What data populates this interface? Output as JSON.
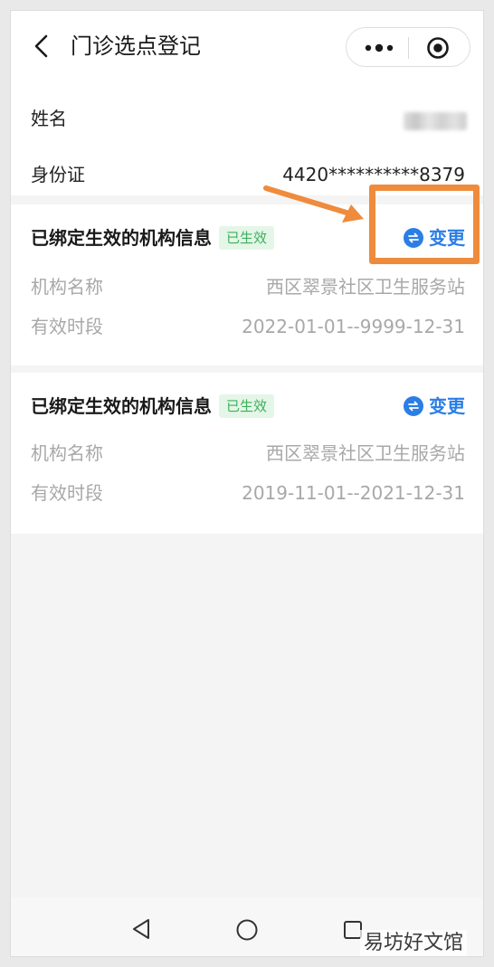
{
  "header": {
    "title": "门诊选点登记",
    "back_icon": "chevron-left-icon",
    "more_icon": "more-dots-icon",
    "close_icon": "target-icon"
  },
  "personal": {
    "name_label": "姓名",
    "id_label": "身份证",
    "id_value": "4420**********8379"
  },
  "org_cards": [
    {
      "title": "已绑定生效的机构信息",
      "badge": "已生效",
      "change_label": "变更",
      "org_name_label": "机构名称",
      "org_name_value": "西区翠景社区卫生服务站",
      "period_label": "有效时段",
      "period_value": "2022-01-01--9999-12-31"
    },
    {
      "title": "已绑定生效的机构信息",
      "badge": "已生效",
      "change_label": "变更",
      "org_name_label": "机构名称",
      "org_name_value": "西区翠景社区卫生服务站",
      "period_label": "有效时段",
      "period_value": "2019-11-01--2021-12-31"
    }
  ],
  "watermark": "易坊好文馆",
  "colors": {
    "accent_blue": "#2a7ee6",
    "badge_green": "#3fae5d",
    "badge_bg": "#e4f6e7",
    "annotation_orange": "#ef8b3c"
  }
}
